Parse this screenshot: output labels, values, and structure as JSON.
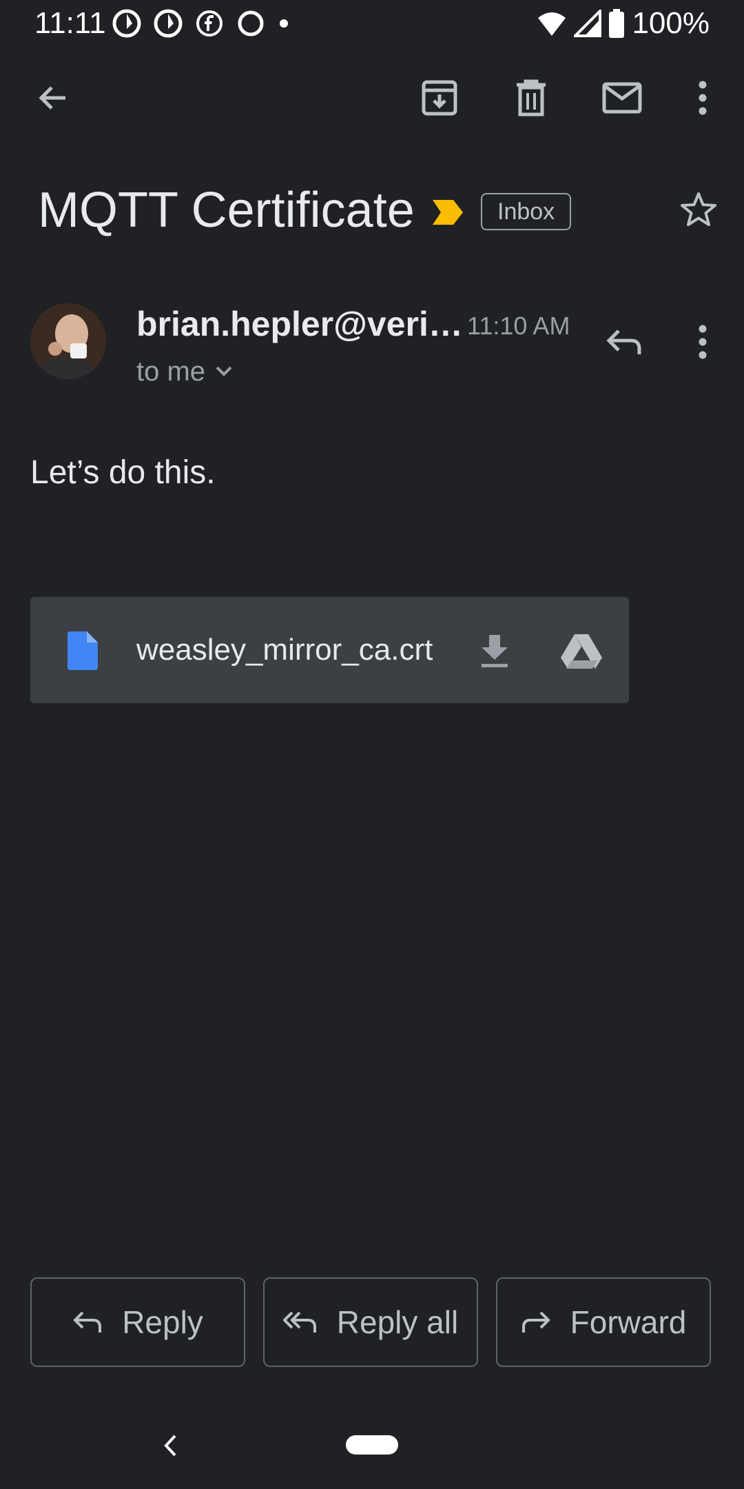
{
  "status_bar": {
    "time": "11:11",
    "battery_percent": "100%"
  },
  "toolbar": {
    "icons": [
      "back-arrow-icon",
      "archive-icon",
      "delete-icon",
      "mark-unread-icon",
      "more-vert-icon"
    ]
  },
  "email": {
    "subject": "MQTT Certificate",
    "label": "Inbox",
    "importance_color": "#fbbc04",
    "sender": "brian.hepler@veri…",
    "time": "11:10 AM",
    "recipient": "to me",
    "body": "Let’s do this."
  },
  "attachment": {
    "filename": "weasley_mirror_ca.crt",
    "file_icon_color": "#4285f4"
  },
  "actions": {
    "reply": "Reply",
    "reply_all": "Reply all",
    "forward": "Forward"
  }
}
